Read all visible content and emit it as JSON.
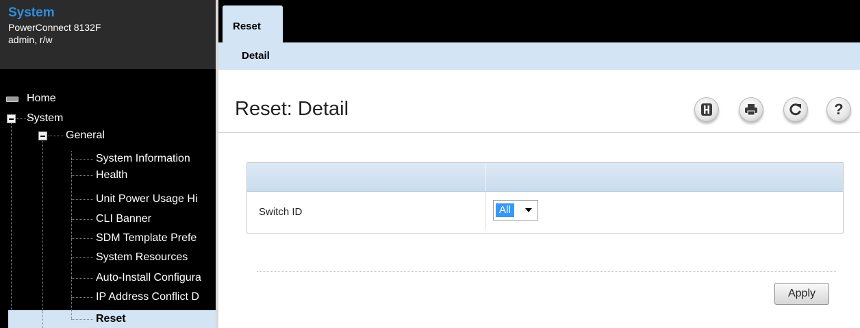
{
  "nav": {
    "system_title": "System",
    "model": "PowerConnect 8132F",
    "user": "admin, r/w",
    "tree": {
      "home": "Home",
      "system": "System",
      "general": "General",
      "children": [
        "System Information",
        "Health",
        "Unit Power Usage Hi",
        "CLI Banner",
        "SDM Template Prefe",
        "System Resources",
        "Auto-Install Configura",
        "IP Address Conflict D",
        "Reset"
      ],
      "selected": "Reset"
    }
  },
  "tabs": {
    "active": "Reset",
    "subtab": "Detail"
  },
  "page": {
    "title": "Reset: Detail"
  },
  "toolbar": {
    "icons": [
      "save-icon",
      "print-icon",
      "refresh-icon",
      "help-icon"
    ]
  },
  "form": {
    "rows": [
      {
        "label": "Switch ID",
        "select_value": "All"
      }
    ],
    "apply_label": "Apply"
  },
  "colors": {
    "accent": "#2d8fe0",
    "selected_bg": "#d3e4f5",
    "tab_bar": "#000000",
    "select_highlight": "#3399ff"
  }
}
